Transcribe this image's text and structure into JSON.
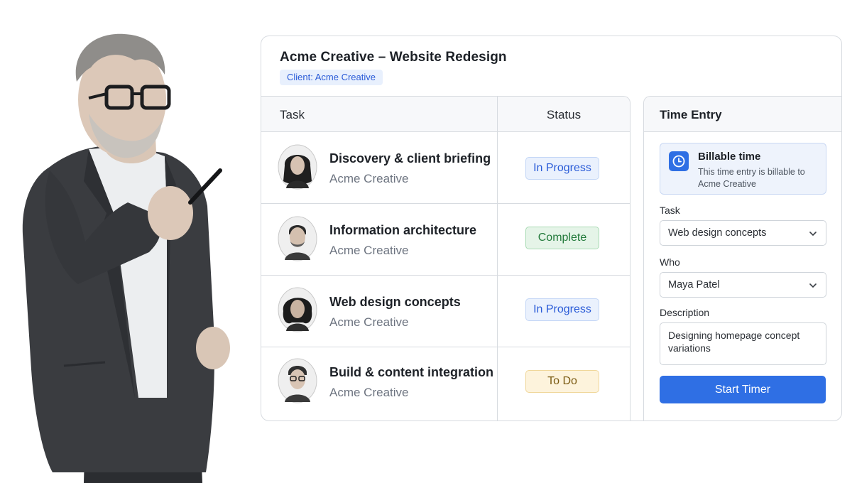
{
  "project": {
    "title": "Acme Creative – Website Redesign",
    "client_chip": "Client: Acme Creative"
  },
  "table": {
    "headers": {
      "task": "Task",
      "status": "Status"
    },
    "rows": [
      {
        "task": "Discovery & client briefing",
        "client": "Acme Creative",
        "status": "In Progress",
        "status_kind": "in-progress"
      },
      {
        "task": "Information architecture",
        "client": "Acme Creative",
        "status": "Complete",
        "status_kind": "complete"
      },
      {
        "task": "Web design concepts",
        "client": "Acme Creative",
        "status": "In Progress",
        "status_kind": "in-progress"
      },
      {
        "task": "Build & content integration",
        "client": "Acme Creative",
        "status": "To Do",
        "status_kind": "to-do"
      }
    ]
  },
  "time_entry": {
    "title": "Time Entry",
    "billable": {
      "title": "Billable time",
      "description": "This time entry is billable to Acme Creative",
      "icon": "clock-icon"
    },
    "task_label": "Task",
    "task_value": "Web design concepts",
    "who_label": "Who",
    "who_value": "Maya Patel",
    "description_label": "Description",
    "description_value": "Designing homepage concept variations",
    "start_button": "Start Timer"
  },
  "colors": {
    "accent": "#2f6fe4",
    "in_progress": "#2a5bd7",
    "complete": "#237a3b",
    "to_do": "#7a5a12"
  }
}
